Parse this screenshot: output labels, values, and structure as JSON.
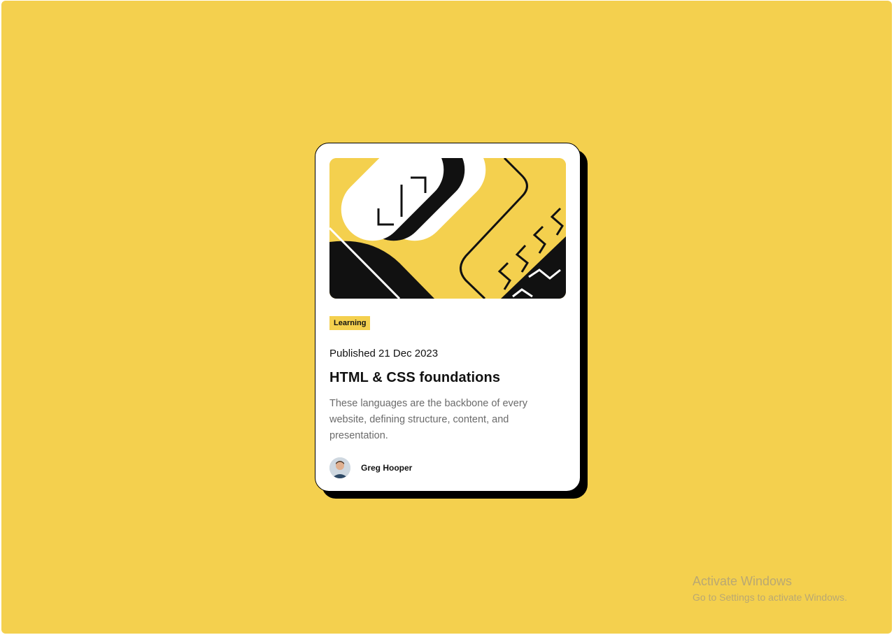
{
  "card": {
    "tag": "Learning",
    "published": "Published 21 Dec 2023",
    "title": "HTML & CSS foundations",
    "description": "These languages are the backbone of every website, defining structure, content, and presentation.",
    "author": "Greg Hooper"
  },
  "watermark": {
    "title": "Activate Windows",
    "subtitle": "Go to Settings to activate Windows."
  },
  "colors": {
    "background": "#f4d04e",
    "card": "#ffffff",
    "ink": "#111111",
    "muted": "#6b6b6b"
  }
}
